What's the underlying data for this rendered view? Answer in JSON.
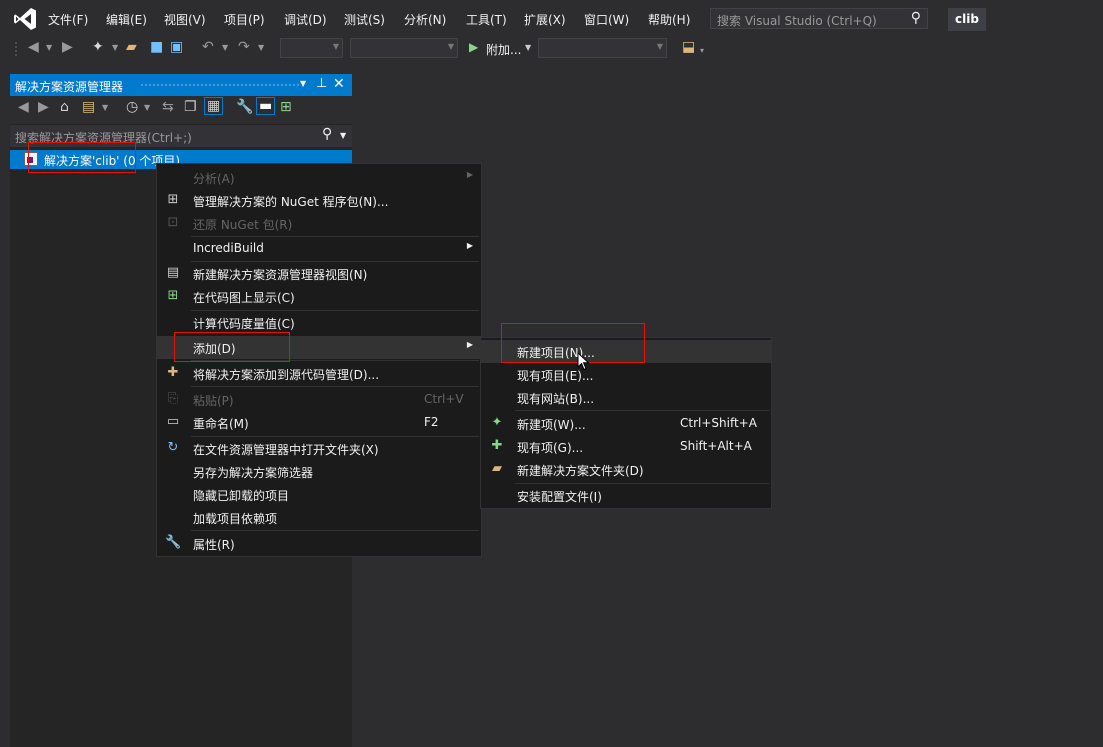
{
  "menubar": {
    "items": [
      "文件(F)",
      "编辑(E)",
      "视图(V)",
      "项目(P)",
      "调试(D)",
      "测试(S)",
      "分析(N)",
      "工具(T)",
      "扩展(X)",
      "窗口(W)",
      "帮助(H)"
    ],
    "search_placeholder": "搜索 Visual Studio (Ctrl+Q)",
    "solution_badge": "clib"
  },
  "toolbar": {
    "attach_label": "附加..."
  },
  "solution_explorer": {
    "title": "解决方案资源管理器",
    "search_placeholder": "搜索解决方案资源管理器(Ctrl+;)",
    "solution_node": "解决方案'clib' (0 个项目)"
  },
  "context_menu": {
    "items": [
      {
        "label": "分析(A)",
        "disabled": true,
        "submenu": true
      },
      {
        "label": "管理解决方案的 NuGet 程序包(N)..."
      },
      {
        "label": "还原 NuGet 包(R)",
        "disabled": true
      },
      {
        "label": "IncrediBuild",
        "submenu": true
      },
      {
        "label": "新建解决方案资源管理器视图(N)"
      },
      {
        "label": "在代码图上显示(C)"
      },
      {
        "label": "计算代码度量值(C)"
      },
      {
        "label": "添加(D)",
        "submenu": true,
        "highlighted": true
      },
      {
        "label": "将解决方案添加到源代码管理(D)..."
      },
      {
        "label": "粘贴(P)",
        "disabled": true,
        "shortcut": "Ctrl+V"
      },
      {
        "label": "重命名(M)",
        "shortcut": "F2"
      },
      {
        "label": "在文件资源管理器中打开文件夹(X)"
      },
      {
        "label": "另存为解决方案筛选器"
      },
      {
        "label": "隐藏已卸载的项目"
      },
      {
        "label": "加载项目依赖项"
      },
      {
        "label": "属性(R)"
      }
    ]
  },
  "add_submenu": {
    "items": [
      {
        "label": "新建项目(N)...",
        "highlighted": true
      },
      {
        "label": "现有项目(E)..."
      },
      {
        "label": "现有网站(B)..."
      },
      {
        "label": "新建项(W)...",
        "shortcut": "Ctrl+Shift+A"
      },
      {
        "label": "现有项(G)...",
        "shortcut": "Shift+Alt+A"
      },
      {
        "label": "新建解决方案文件夹(D)"
      },
      {
        "label": "安装配置文件(I)"
      }
    ]
  },
  "colors": {
    "accent": "#007acc",
    "background": "#2d2d30",
    "menu_background": "#1b1b1c",
    "highlight_box": "#e51400"
  }
}
